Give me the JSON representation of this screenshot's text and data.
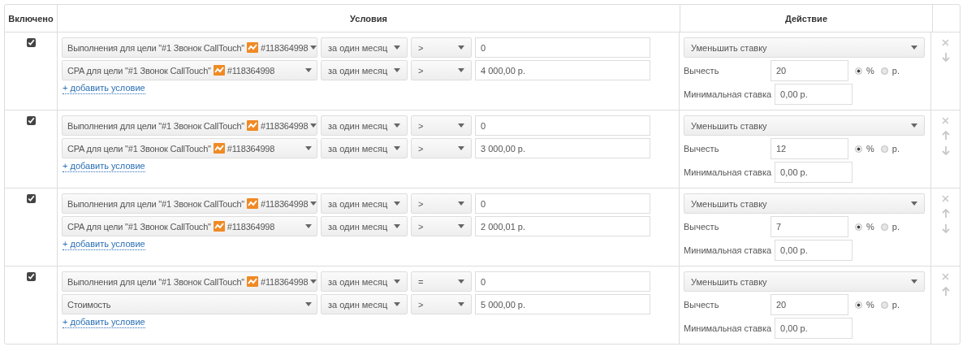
{
  "columns": [
    "Включено",
    "Условия",
    "Действие"
  ],
  "rules": [
    {
      "enabled": true,
      "conditions": [
        {
          "metric": "Выполнения для цели \"#1 Звонок CallTouch\"",
          "goal_id": "#118364998",
          "period": "за один месяц",
          "operator": ">",
          "value": "0"
        },
        {
          "metric": "CPA для цели \"#1 Звонок CallTouch\"",
          "goal_id": "#118364998",
          "period": "за один месяц",
          "operator": ">",
          "value": "4 000,00 р."
        }
      ],
      "add_link": "+ добавить условие",
      "action": "Уменьшить ставку",
      "subtract_label": "Вычесть",
      "subtract": "20",
      "units": [
        {
          "label": "%",
          "selected": true
        },
        {
          "label": "р.",
          "selected": false
        }
      ],
      "min_label": "Минимальная ставка",
      "min_bid": "0,00 р.",
      "move_up": false,
      "move_down": true
    },
    {
      "enabled": true,
      "conditions": [
        {
          "metric": "Выполнения для цели \"#1 Звонок CallTouch\"",
          "goal_id": "#118364998",
          "period": "за один месяц",
          "operator": ">",
          "value": "0"
        },
        {
          "metric": "CPA для цели \"#1 Звонок CallTouch\"",
          "goal_id": "#118364998",
          "period": "за один месяц",
          "operator": ">",
          "value": "3 000,00 р."
        }
      ],
      "add_link": "+ добавить условие",
      "action": "Уменьшить ставку",
      "subtract_label": "Вычесть",
      "subtract": "12",
      "units": [
        {
          "label": "%",
          "selected": true
        },
        {
          "label": "р.",
          "selected": false
        }
      ],
      "min_label": "Минимальная ставка",
      "min_bid": "0,00 р.",
      "move_up": true,
      "move_down": true
    },
    {
      "enabled": true,
      "conditions": [
        {
          "metric": "Выполнения для цели \"#1 Звонок CallTouch\"",
          "goal_id": "#118364998",
          "period": "за один месяц",
          "operator": ">",
          "value": "0"
        },
        {
          "metric": "CPA для цели \"#1 Звонок CallTouch\"",
          "goal_id": "#118364998",
          "period": "за один месяц",
          "operator": ">",
          "value": "2 000,01 р."
        }
      ],
      "add_link": "+ добавить условие",
      "action": "Уменьшить ставку",
      "subtract_label": "Вычесть",
      "subtract": "7",
      "units": [
        {
          "label": "%",
          "selected": true
        },
        {
          "label": "р.",
          "selected": false
        }
      ],
      "min_label": "Минимальная ставка",
      "min_bid": "0,00 р.",
      "move_up": true,
      "move_down": true
    },
    {
      "enabled": true,
      "conditions": [
        {
          "metric": "Выполнения для цели \"#1 Звонок CallTouch\"",
          "goal_id": "#118364998",
          "period": "за один месяц",
          "operator": "=",
          "value": "0"
        },
        {
          "metric": "Стоимость",
          "period": "за один месяц",
          "operator": ">",
          "value": "5 000,00 р."
        }
      ],
      "add_link": "+ добавить условие",
      "action": "Уменьшить ставку",
      "subtract_label": "Вычесть",
      "subtract": "20",
      "units": [
        {
          "label": "%",
          "selected": true
        },
        {
          "label": "р.",
          "selected": false
        }
      ],
      "min_label": "Минимальная ставка",
      "min_bid": "0,00 р.",
      "move_up": true,
      "move_down": false
    }
  ]
}
